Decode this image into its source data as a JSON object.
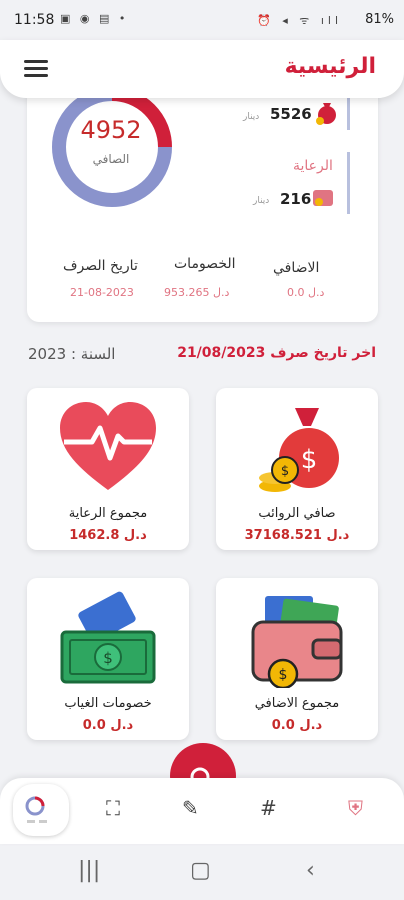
{
  "status": {
    "time": "11:58",
    "battery": "81%"
  },
  "header": {
    "title": "الرئيسية"
  },
  "summary": {
    "net_value": "4952",
    "net_label": "الصافي",
    "top_amount": "5526",
    "top_unit": "دينار",
    "care_label": "الرعاية",
    "care_amount": "216",
    "care_unit": "دينار",
    "columns": [
      {
        "title": "الاضافي",
        "value": "0.0 د.ل"
      },
      {
        "title": "الخصومات",
        "value": "953.265 د.ل"
      },
      {
        "title": "تاريخ الصرف",
        "value": "21-08-2023"
      }
    ]
  },
  "section": {
    "year": "السنة : 2023",
    "last_payment": "اخر تاريخ صرف 21/08/2023"
  },
  "tiles": [
    {
      "label": "صافي الروائب",
      "value": "37168.521 د.ل",
      "icon": "money-bag-icon"
    },
    {
      "label": "مجموع الرعاية",
      "value": "1462.8 د.ل",
      "icon": "heart-icon"
    },
    {
      "label": "مجموع الاضافي",
      "value": "0.0 د.ل",
      "icon": "wallet-icon"
    },
    {
      "label": "خصومات الغياب",
      "value": "0.0 د.ل",
      "icon": "cash-icon"
    }
  ],
  "toolbar": {
    "hash": "#"
  },
  "colors": {
    "accent": "#d0203a",
    "ring_blue": "#8a93cc",
    "ring_red": "#d0203a"
  }
}
